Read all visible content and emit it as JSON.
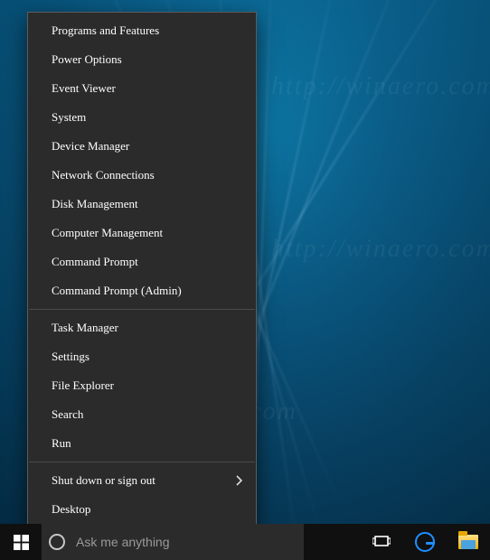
{
  "menu": {
    "groups": [
      [
        {
          "label": "Programs and Features",
          "submenu": false
        },
        {
          "label": "Power Options",
          "submenu": false
        },
        {
          "label": "Event Viewer",
          "submenu": false
        },
        {
          "label": "System",
          "submenu": false
        },
        {
          "label": "Device Manager",
          "submenu": false
        },
        {
          "label": "Network Connections",
          "submenu": false
        },
        {
          "label": "Disk Management",
          "submenu": false
        },
        {
          "label": "Computer Management",
          "submenu": false
        },
        {
          "label": "Command Prompt",
          "submenu": false
        },
        {
          "label": "Command Prompt (Admin)",
          "submenu": false
        }
      ],
      [
        {
          "label": "Task Manager",
          "submenu": false
        },
        {
          "label": "Settings",
          "submenu": false
        },
        {
          "label": "File Explorer",
          "submenu": false
        },
        {
          "label": "Search",
          "submenu": false
        },
        {
          "label": "Run",
          "submenu": false
        }
      ],
      [
        {
          "label": "Shut down or sign out",
          "submenu": true
        },
        {
          "label": "Desktop",
          "submenu": false
        }
      ]
    ]
  },
  "taskbar": {
    "search_placeholder": "Ask me anything",
    "search_value": "",
    "icons": {
      "start": "start-icon",
      "taskview": "task-view-icon",
      "edge": "edge-icon",
      "explorer": "file-explorer-icon"
    }
  },
  "watermark_text": "http://winaero.com",
  "colors": {
    "menu_bg": "#2b2b2b",
    "menu_border": "#5c5c5c",
    "taskbar_bg": "#101010",
    "accent": "#1e90ff"
  }
}
